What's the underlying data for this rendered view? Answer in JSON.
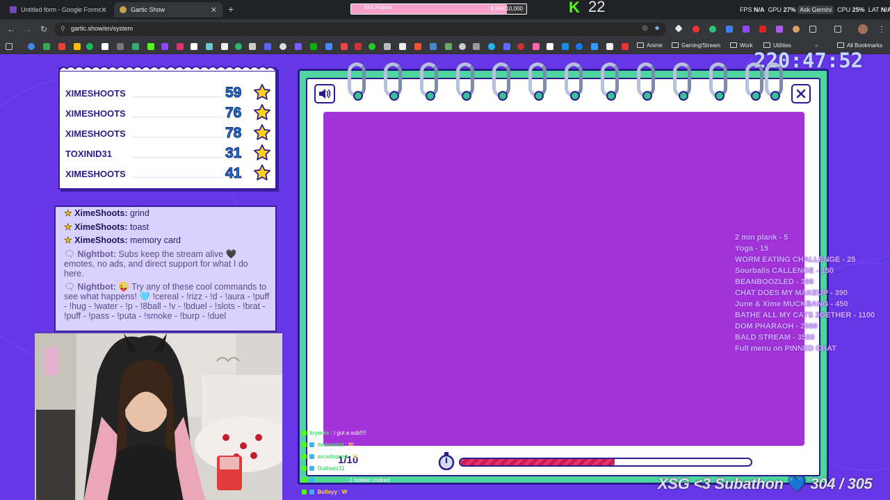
{
  "browser": {
    "tabs": [
      {
        "title": "Untitled form - Google Forms",
        "active": false,
        "favicon_color": "#7248b9"
      },
      {
        "title": "Gartic Show",
        "active": true,
        "favicon_color": "#c9a24a"
      }
    ],
    "url": "gartic.show/en/system"
  },
  "follows_goal": {
    "label": "XSG Follows",
    "current": "8,889",
    "goal": "/10,000",
    "progress": 0.8889
  },
  "kick": {
    "letter": "K",
    "count": "22"
  },
  "system_stats": {
    "fps_label": "FPS",
    "fps": "N/A",
    "gpu_label": "GPU",
    "gpu": "27%",
    "gemini": "Ask Gemini",
    "cpu_label": "CPU",
    "cpu": "25%",
    "lat_label": "LAT",
    "lat": "N/A"
  },
  "bookmarks": [
    "Anime",
    "Gaming/Stream",
    "Work",
    "Utilities",
    "All Bookmarks"
  ],
  "stream_timer": "220:47:52",
  "scoreboard": [
    {
      "name": "XIMESHOOTS",
      "score": "59"
    },
    {
      "name": "XIMESHOOTS",
      "score": "76"
    },
    {
      "name": "XIMESHOOTS",
      "score": "78"
    },
    {
      "name": "TOXINID31",
      "score": "31"
    },
    {
      "name": "XIMESHOOTS",
      "score": "41"
    }
  ],
  "game_chat": [
    {
      "user": "XimeShoots:",
      "text": "grind"
    },
    {
      "user": "XimeShoots:",
      "text": "toast"
    },
    {
      "user": "XimeShoots:",
      "text": "memory card"
    },
    {
      "user": "Nightbot:",
      "text": "Subs keep the stream alive 🖤 emotes, no ads, and direct support for what I do here."
    },
    {
      "user": "Nightbot:",
      "text": "😜 Try any of these cool commands to see what happens! 🩵 !cereal - !rizz - !d - !aura - !puff - !hug - !water - !p - !8ball - !v - !bduel - !slots - !brat - !puff - !pass - !puta - !smoke - !burp - !duel"
    }
  ],
  "game": {
    "round": "1/10",
    "timer_fraction": 0.53
  },
  "subathon_menu": [
    "2 min plank - 5",
    "Yoga - 15",
    "WORM EATING CHALLENGE - 25",
    "Sourballs CALLENGE - 150",
    "BEANBOOZLED - 300",
    "CHAT DOES MY MAKEUP - 390",
    "June & Xime MUCKBANG - 450",
    "BATHE ALL MY CATS 2GETHER - 1100",
    "DOM PHARAOH - 2000",
    "BALD STREAM - 3500",
    "Full menu on PINNED CHAT"
  ],
  "overlay_chat": [
    {
      "user": "krymke",
      "text": "I got a sub!!!!",
      "color": "#47e36f"
    },
    {
      "user": "itsdeonlol",
      "text": "W",
      "color": "#47e36f"
    },
    {
      "user": "arcadeprod",
      "text": "W",
      "color": "#47e36f"
    },
    {
      "user": "Outlawz11",
      "text": "I can wear it now",
      "color": "#47e36f"
    },
    {
      "user": "Outlawz11",
      "text": "2 looked cooked",
      "color": "#47e36f"
    },
    {
      "user": "Bolleyy",
      "text": "W",
      "color": "#ffd25a"
    }
  ],
  "subathon": {
    "label": "XSG <3 Subathon",
    "heart": "💙",
    "count": "304 / 305"
  },
  "colors": {
    "page_bg": "#6637e6",
    "canvas": "#a333d8",
    "board_green": "#4ed69f",
    "timer_fill": "#e8306d"
  }
}
